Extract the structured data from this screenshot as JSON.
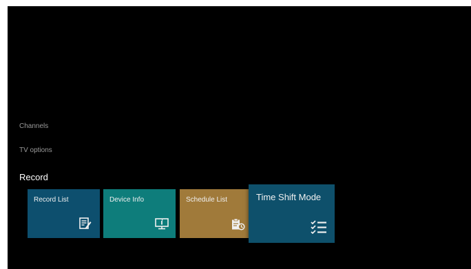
{
  "menu": {
    "items": [
      {
        "label": "Channels"
      },
      {
        "label": "TV options"
      }
    ],
    "section_title": "Record"
  },
  "tiles": [
    {
      "label": "Record List",
      "icon": "record-list-icon",
      "color": "#0d4f6e"
    },
    {
      "label": "Device Info",
      "icon": "device-info-icon",
      "color": "#0e7d7b"
    },
    {
      "label": "Schedule List",
      "icon": "schedule-list-icon",
      "color": "#a07a3a"
    },
    {
      "label": "Time Shift Mode",
      "icon": "checklist-icon",
      "color": "#0e506b",
      "focused": true
    }
  ]
}
